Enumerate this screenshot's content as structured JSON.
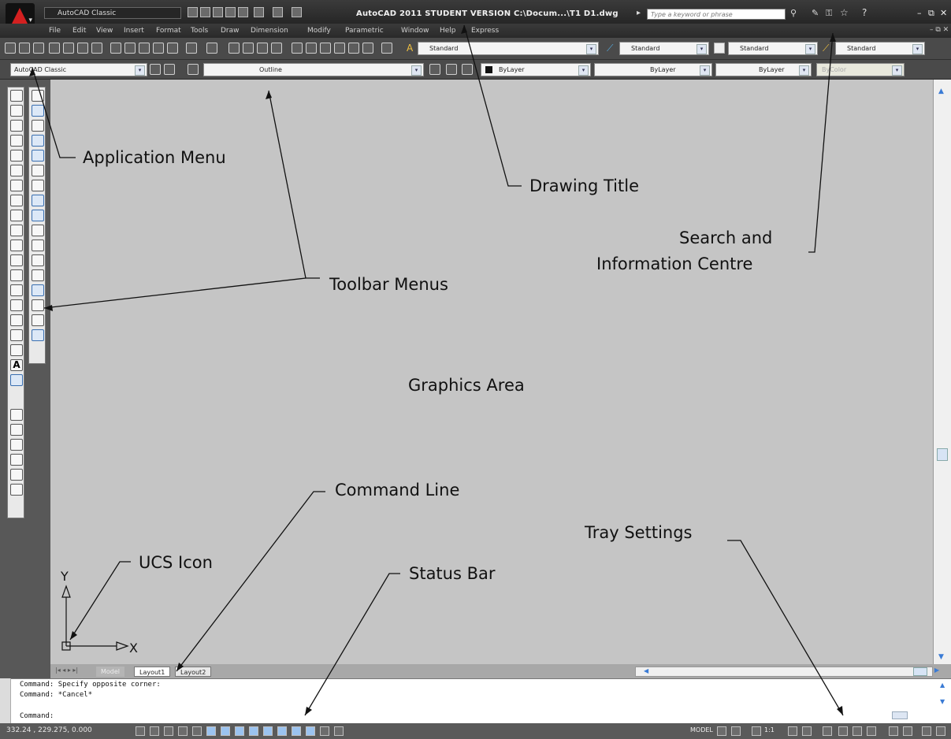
{
  "title_bar": {
    "workspace_combo": "AutoCAD Classic",
    "app_title": "AutoCAD 2011   STUDENT VERSION   C:\\Docum...\\T1 D1.dwg",
    "search_placeholder": "Type a keyword or phrase",
    "window_controls": [
      "–",
      "⧉",
      "✕"
    ]
  },
  "menu_bar": {
    "items": [
      "File",
      "Edit",
      "View",
      "Insert",
      "Format",
      "Tools",
      "Draw",
      "Dimension",
      "Modify",
      "Parametric",
      "Window",
      "Help",
      "Express"
    ]
  },
  "toolbar1": {
    "text_style": "Standard",
    "dim_style": "Standard",
    "table_style": "Standard",
    "mleader_style": "Standard"
  },
  "toolbar2": {
    "workspace": "AutoCAD Classic",
    "layer": "Outline",
    "color": "ByLayer",
    "linetype": "ByLayer",
    "lineweight": "ByLayer",
    "plot_style": "ByColor"
  },
  "layout_tabs": {
    "items": [
      "Model",
      "Layout1",
      "Layout2"
    ]
  },
  "command_area": {
    "lines": [
      "Command: Specify opposite corner:",
      "Command: *Cancel*",
      "",
      "Command:"
    ]
  },
  "status_bar": {
    "coordinates": "332.24 , 229.275, 0.000",
    "model_label": "MODEL",
    "scale": "1:1"
  },
  "ucs": {
    "y_label": "Y",
    "x_label": "X"
  },
  "annotations": {
    "application_menu": "Application Menu",
    "drawing_title": "Drawing Title",
    "search_line1": "Search and",
    "search_line2": "Information Centre",
    "toolbar_menus": "Toolbar Menus",
    "graphics_area": "Graphics Area",
    "command_line": "Command Line",
    "tray_settings": "Tray Settings",
    "ucs_icon": "UCS Icon",
    "status_bar": "Status Bar"
  },
  "colors": {
    "graphics_bg": "#c5c5c5",
    "title_bg": "#2e2e2e",
    "app_red": "#d32020"
  }
}
